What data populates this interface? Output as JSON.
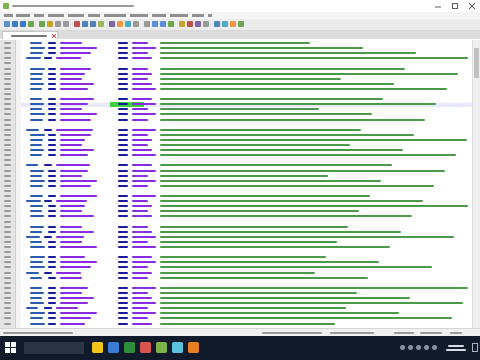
{
  "colors": {
    "accent": "#7fb24a",
    "keyword": "#2a5db0",
    "string": "#8a2be2",
    "comment": "#4a9a4a",
    "tag": "#1a1a9a",
    "highlight": "#3bd23b",
    "taskbar": "#101a2a"
  },
  "icons": {
    "app": "notepad-plus-plus-icon",
    "minimize": "minimize-icon",
    "maximize": "maximize-icon",
    "close": "close-icon",
    "start": "windows-start-icon"
  }
}
